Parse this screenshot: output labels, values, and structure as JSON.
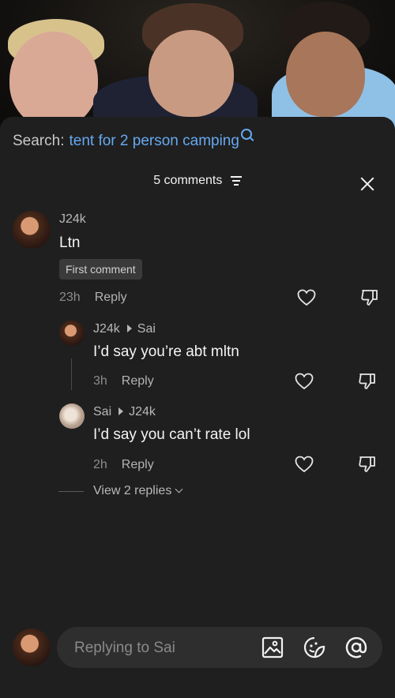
{
  "search": {
    "label": "Search:",
    "query": "tent for 2 person camping"
  },
  "header": {
    "comment_count": "5 comments"
  },
  "comments": [
    {
      "username": "J24k",
      "text": "Ltn",
      "badge": "First comment",
      "time": "23h",
      "reply_label": "Reply"
    }
  ],
  "replies": [
    {
      "username": "J24k",
      "reply_to": "Sai",
      "text": "I’d say you’re abt mltn",
      "time": "3h",
      "reply_label": "Reply"
    },
    {
      "username": "Sai",
      "reply_to": "J24k",
      "text": "I’d say you can’t rate lol",
      "time": "2h",
      "reply_label": "Reply"
    }
  ],
  "view_replies": "View 2 replies",
  "composer": {
    "placeholder": "Replying to Sai"
  },
  "colors": {
    "accent_link": "#66a9f0",
    "sheet_bg": "#1f1f1f"
  }
}
